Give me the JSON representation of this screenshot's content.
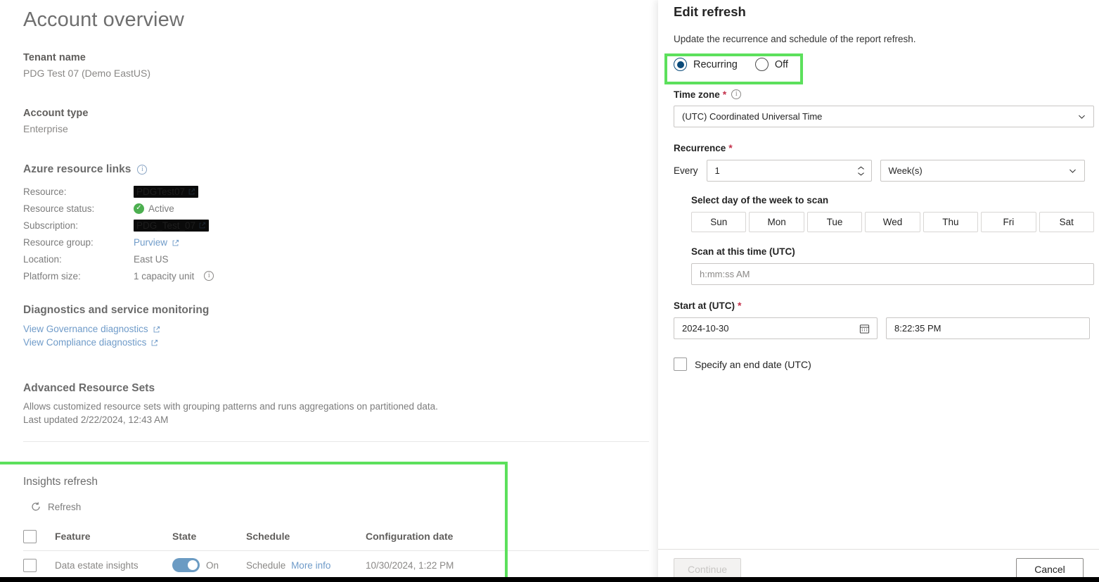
{
  "main": {
    "page_title": "Account overview",
    "tenant": {
      "label": "Tenant name",
      "value": "PDG Test 07 (Demo EastUS)"
    },
    "account_type": {
      "label": "Account type",
      "value": "Enterprise"
    },
    "azure_resource_links": {
      "heading": "Azure resource links",
      "rows": [
        {
          "key": "Resource:",
          "value": "PDGTest07",
          "redacted": true,
          "link": true
        },
        {
          "key": "Resource status:",
          "value": "Active",
          "redacted": false,
          "link": false
        },
        {
          "key": "Subscription:",
          "value": "PDG_Test_07",
          "redacted": true,
          "link": true
        },
        {
          "key": "Resource group:",
          "value": "Purview",
          "redacted": false,
          "link": true
        },
        {
          "key": "Location:",
          "value": "East US",
          "redacted": false,
          "link": false
        },
        {
          "key": "Platform size:",
          "value": "1 capacity unit",
          "redacted": false,
          "link": false
        }
      ]
    },
    "diagnostics": {
      "heading": "Diagnostics and service monitoring",
      "links": [
        "View Governance diagnostics",
        "View Compliance diagnostics"
      ]
    },
    "advanced_resource_sets": {
      "heading": "Advanced Resource Sets",
      "description": "Allows customized resource sets with grouping patterns and runs aggregations on partitioned data.",
      "last_updated": "Last updated 2/22/2024, 12:43 AM"
    },
    "insights_refresh": {
      "heading": "Insights refresh",
      "refresh_label": "Refresh",
      "columns": [
        "Feature",
        "State",
        "Schedule",
        "Configuration date"
      ],
      "rows": [
        {
          "feature": "Data estate insights",
          "state_label": "On",
          "state_on": true,
          "schedule": "Schedule",
          "schedule_link": "More info",
          "configuration_date": "10/30/2024, 1:22 PM"
        }
      ]
    }
  },
  "panel": {
    "title": "Edit refresh",
    "subtitle": "Update the recurrence and schedule of the report refresh.",
    "mode": {
      "selected": "Recurring",
      "options": [
        "Recurring",
        "Off"
      ]
    },
    "time_zone": {
      "label": "Time zone",
      "required": "*",
      "value": "(UTC) Coordinated Universal Time"
    },
    "recurrence": {
      "label": "Recurrence",
      "required": "*",
      "every_label": "Every",
      "every_value": "1",
      "unit_value": "Week(s)"
    },
    "day_picker": {
      "label": "Select day of the week to scan",
      "days": [
        "Sun",
        "Mon",
        "Tue",
        "Wed",
        "Thu",
        "Fri",
        "Sat"
      ]
    },
    "scan_time": {
      "label": "Scan at this time (UTC)",
      "placeholder": "h:mm:ss AM",
      "value": ""
    },
    "start_at": {
      "label": "Start at (UTC)",
      "required": "*",
      "date_value": "2024-10-30",
      "time_value": "8:22:35 PM"
    },
    "end_date_checkbox": {
      "label": "Specify an end date (UTC)",
      "checked": false
    },
    "footer": {
      "continue_label": "Continue",
      "cancel_label": "Cancel"
    }
  },
  "highlights": {
    "color": "#5ce05c"
  }
}
